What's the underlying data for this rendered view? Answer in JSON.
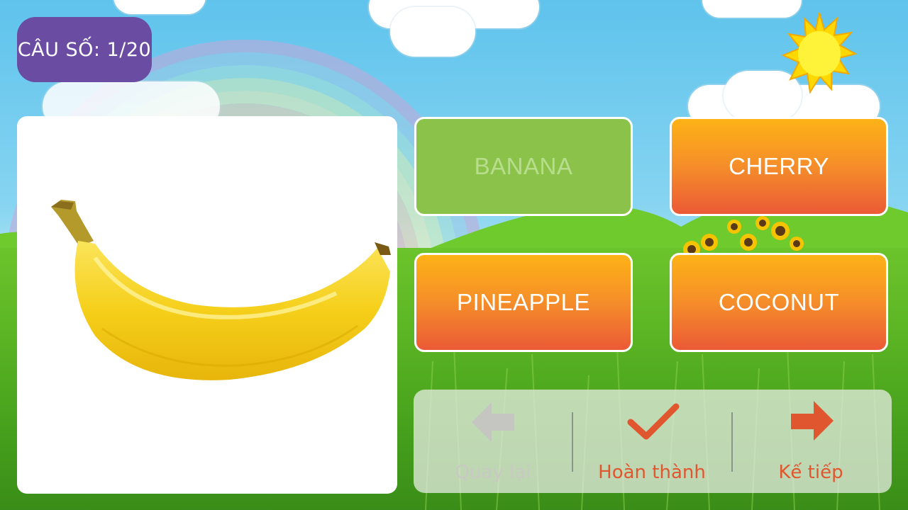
{
  "header": {
    "question_counter": "CÂU SỐ: 1/20"
  },
  "question": {
    "image_icon": "banana-illustration"
  },
  "answers": [
    {
      "label": "BANANA",
      "state": "selected"
    },
    {
      "label": "CHERRY",
      "state": "default"
    },
    {
      "label": "PINEAPPLE",
      "state": "default"
    },
    {
      "label": "COCONUT",
      "state": "default"
    }
  ],
  "nav": {
    "back_label": "Quay lại",
    "back_icon": "arrow-left-icon",
    "done_label": "Hoàn thành",
    "done_icon": "checkmark-icon",
    "next_label": "Kế tiếp",
    "next_icon": "arrow-right-icon"
  },
  "colors": {
    "badge": "#6a4ca3",
    "answer_orange_top": "#fdb316",
    "answer_orange_bottom": "#eb5a36",
    "answer_selected": "#8bc34a",
    "nav_active": "#e0562f",
    "nav_disabled": "#c9c9c4"
  }
}
